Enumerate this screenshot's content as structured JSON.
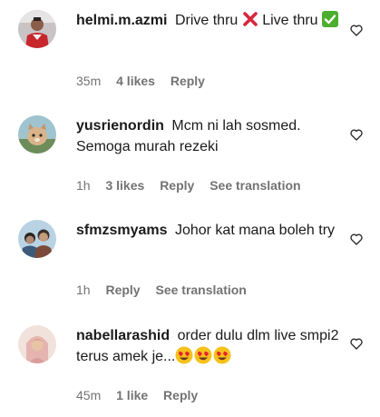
{
  "colors": {
    "text": "#1a1a1a",
    "meta": "#737373",
    "background": "#ffffff"
  },
  "comments": [
    {
      "username": "helmi.m.azmi",
      "text_a": "Drive thru",
      "text_b": "Live thru",
      "emoji_a": "cross-mark-emoji",
      "emoji_b": "check-mark-button-emoji",
      "time": "35m",
      "likes": "4 likes",
      "reply": "Reply",
      "heart_icon": "heart-outline-icon"
    },
    {
      "username": "yusrienordin",
      "text": "Mcm ni lah sosmed. Semoga murah rezeki",
      "time": "1h",
      "likes": "3 likes",
      "reply": "Reply",
      "translate": "See translation",
      "heart_icon": "heart-outline-icon"
    },
    {
      "username": "sfmzsmyams",
      "text": "Johor kat mana boleh try",
      "time": "1h",
      "reply": "Reply",
      "translate": "See translation",
      "heart_icon": "heart-outline-icon"
    },
    {
      "username": "nabellarashid",
      "text": "order dulu dlm live smpi2 terus amek je...",
      "emoji": "smiling-face-with-heart-eyes-emoji",
      "time": "45m",
      "likes": "1 like",
      "reply": "Reply",
      "heart_icon": "heart-outline-icon"
    }
  ]
}
